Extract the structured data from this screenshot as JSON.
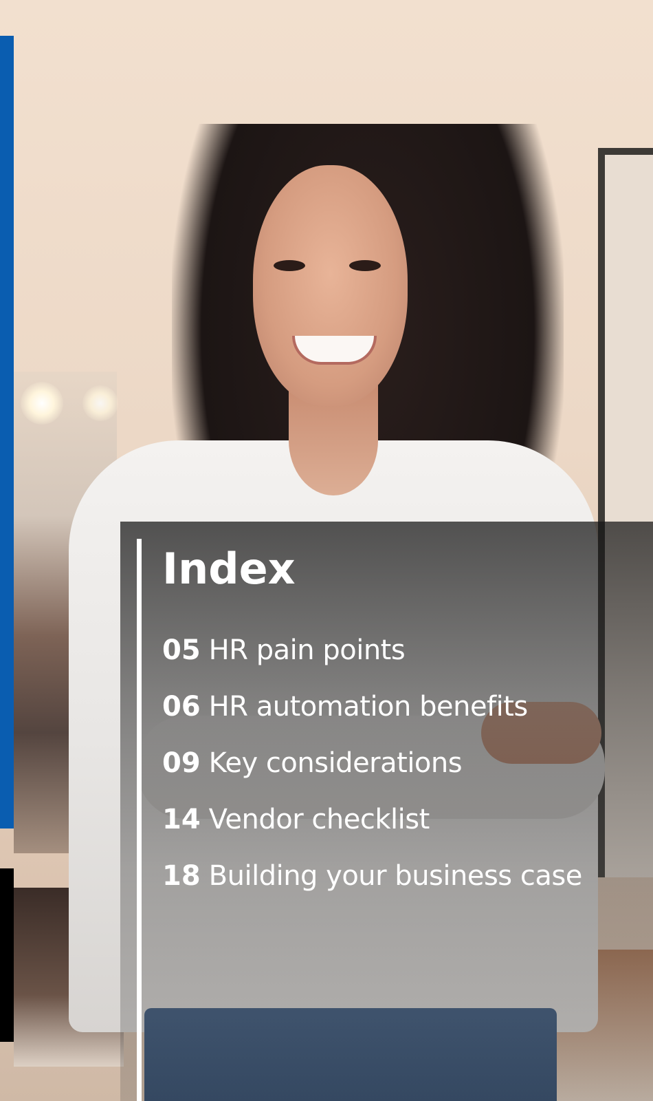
{
  "index": {
    "title": "Index",
    "items": [
      {
        "page": "05",
        "label": "HR pain points"
      },
      {
        "page": "06",
        "label": "HR automation benefits"
      },
      {
        "page": "09",
        "label": "Key considerations"
      },
      {
        "page": "14",
        "label": "Vendor checklist"
      },
      {
        "page": "18",
        "label": "Building your business case"
      }
    ]
  },
  "colors": {
    "brand_blue": "#0a5db0",
    "brand_black": "#000000",
    "text": "#ffffff"
  }
}
